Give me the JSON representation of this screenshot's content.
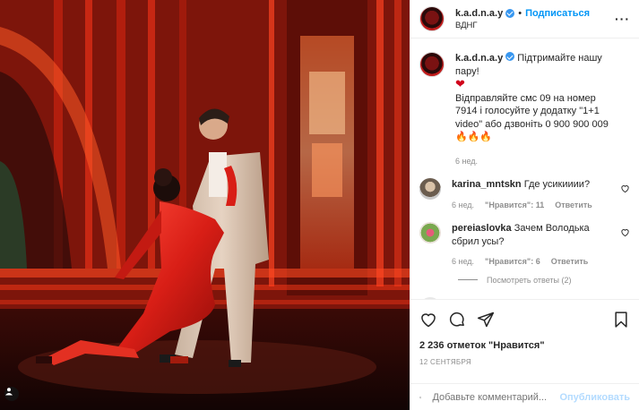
{
  "post": {
    "username": "k.a.d.n.a.y",
    "separator": "•",
    "follow_label": "Подписаться",
    "location": "ВДНГ",
    "more_label": "···"
  },
  "caption": {
    "username": "k.a.d.n.a.y",
    "text_line1": "Підтримайте нашу пару!",
    "heart": "❤",
    "text_body": "Відправляйте смс 09 на номер 7914 і голосуйте у додатку \"1+1 video\" або дзвоніть 0 900 900 009",
    "fire": "🔥🔥🔥",
    "age": "6 нед."
  },
  "comments": [
    {
      "username": "karina_mntskn",
      "text": "Где усикииии?",
      "age": "6 нед.",
      "likes": "\"Нравится\": 11",
      "reply_label": "Ответить"
    },
    {
      "username": "pereiaslovka",
      "text": "Зачем Володька сбрил усы?",
      "age": "6 нед.",
      "likes": "\"Нравится\": 6",
      "reply_label": "Ответить",
      "view_replies": "Посмотреть ответы (2)"
    }
  ],
  "engagement": {
    "likes_text": "2 236 отметок \"Нравится\"",
    "date": "12 СЕНТЯБРЯ"
  },
  "composer": {
    "placeholder": "Добавьте комментарий...",
    "publish_label": "Опубликовать"
  },
  "icons": {
    "like": "heart-icon",
    "comment": "comment-icon",
    "share": "paper-plane-icon",
    "save": "bookmark-icon",
    "emoji": "smiley-icon",
    "tag": "person-tag-icon"
  },
  "colors": {
    "accent": "#0095f6",
    "verified": "#3897f0",
    "muted": "#8e8e8e",
    "stage_red": "#c41d10"
  }
}
